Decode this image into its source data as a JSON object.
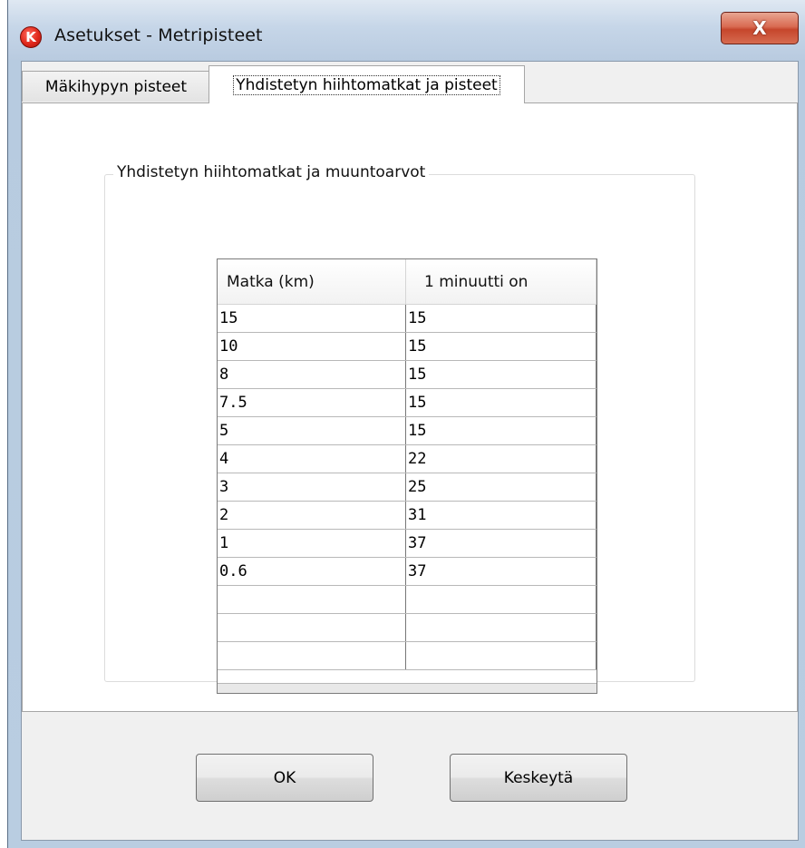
{
  "window": {
    "title": "Asetukset - Metripisteet",
    "app_icon_glyph": "K",
    "close_glyph": "X",
    "accent_color": "#d3442b"
  },
  "tabs": [
    {
      "label": "Mäkihypyn pisteet",
      "active": false
    },
    {
      "label": "Yhdistetyn hiihtomatkat ja pisteet",
      "active": true
    }
  ],
  "groupbox": {
    "title": "Yhdistetyn hiihtomatkat ja muuntoarvot"
  },
  "table": {
    "columns": [
      "Matka (km)",
      "1 minuutti on"
    ],
    "rows": [
      [
        "15",
        "15"
      ],
      [
        "10",
        "15"
      ],
      [
        "8",
        "15"
      ],
      [
        "7.5",
        "15"
      ],
      [
        "5",
        "15"
      ],
      [
        "4",
        "22"
      ],
      [
        "3",
        "25"
      ],
      [
        "2",
        "31"
      ],
      [
        "1",
        "37"
      ],
      [
        "0.6",
        "37"
      ],
      [
        "",
        ""
      ],
      [
        "",
        ""
      ],
      [
        "",
        ""
      ]
    ]
  },
  "buttons": {
    "ok": "OK",
    "cancel": "Keskeytä"
  }
}
